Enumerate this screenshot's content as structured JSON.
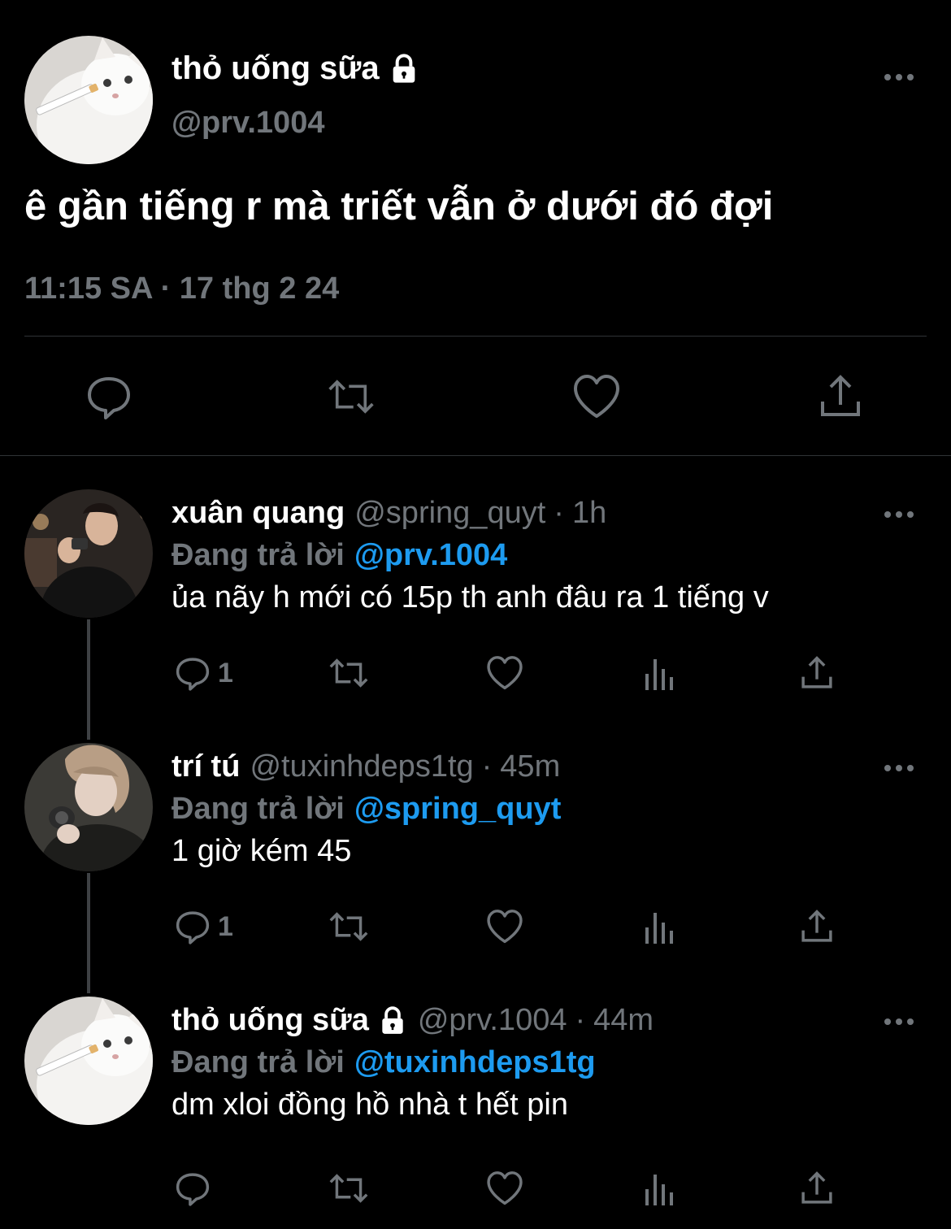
{
  "main_tweet": {
    "author": {
      "name": "thỏ uống sữa",
      "handle": "@prv.1004",
      "protected": true,
      "avatar": "white-cat-avatar"
    },
    "text": "ê gần tiếng r mà triết vẫn ở dưới đó đợi",
    "timestamp": "11:15 SA · 17 thg 2 24",
    "actions": [
      "reply-icon",
      "retweet-icon",
      "like-icon",
      "share-icon"
    ]
  },
  "replies": [
    {
      "author": {
        "name": "xuân quang",
        "handle": "@spring_quyt",
        "avatar": "person-camera-avatar"
      },
      "time": "1h",
      "replying_label": "Đang trả lời",
      "replying_to": "@prv.1004",
      "text": "ủa nãy h mới có 15p th anh đâu ra 1 tiếng v",
      "reply_count": "1"
    },
    {
      "author": {
        "name": "trí tú",
        "handle": "@tuxinhdeps1tg",
        "avatar": "person-photo-avatar"
      },
      "time": "45m",
      "replying_label": "Đang trả lời",
      "replying_to": "@spring_quyt",
      "text": "1 giờ kém 45",
      "reply_count": "1"
    },
    {
      "author": {
        "name": "thỏ uống sữa",
        "handle": "@prv.1004",
        "protected": true,
        "avatar": "white-cat-avatar"
      },
      "time": "44m",
      "replying_label": "Đang trả lời",
      "replying_to": "@tuxinhdeps1tg",
      "text": "dm xloi đồng hồ nhà t hết pin",
      "reply_count": ""
    }
  ],
  "colors": {
    "background": "#000000",
    "text_primary": "#ffffff",
    "text_secondary": "#71767b",
    "accent": "#1d9bf0",
    "divider": "#2f3336"
  }
}
